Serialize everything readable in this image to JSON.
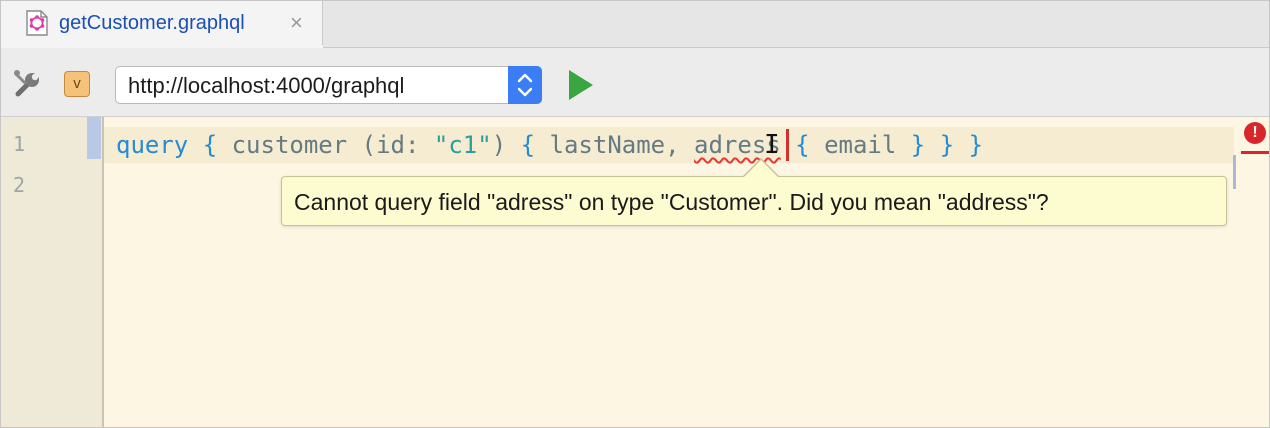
{
  "tab": {
    "icon": "graphql-file-icon",
    "label": "getCustomer.graphql",
    "close_glyph": "×",
    "close_icon": "close-icon"
  },
  "toolbar": {
    "settings_icon": "wrench-icon",
    "variables_badge": "v",
    "endpoint": "http://localhost:4000/graphql",
    "run_icon": "run-icon"
  },
  "editor": {
    "line_numbers": [
      "1",
      "2"
    ],
    "code_line_1": {
      "kw_query": "query",
      "brace_open_1": "{",
      "ident_customer": "customer",
      "paren_open": "(id:",
      "string_c1": "\"c1\"",
      "paren_close": ")",
      "brace_open_2": "{",
      "ident_lastName": "lastName,",
      "error_field": "adress",
      "brace_open_3": "{",
      "ident_email": "email",
      "brace_close_3": "}",
      "brace_close_2": "}",
      "brace_close_1": "}"
    },
    "error_indicator": "!",
    "tooltip": "Cannot query field \"adress\" on type \"Customer\". Did you mean \"address\"?"
  },
  "colors": {
    "editor_background": "#fdf6e3",
    "keyword": "#268bd2",
    "identifier": "#657b83",
    "string": "#2aa198",
    "error": "#d9262b",
    "run_green": "#3aa640",
    "stepper_blue": "#3b7df5"
  }
}
